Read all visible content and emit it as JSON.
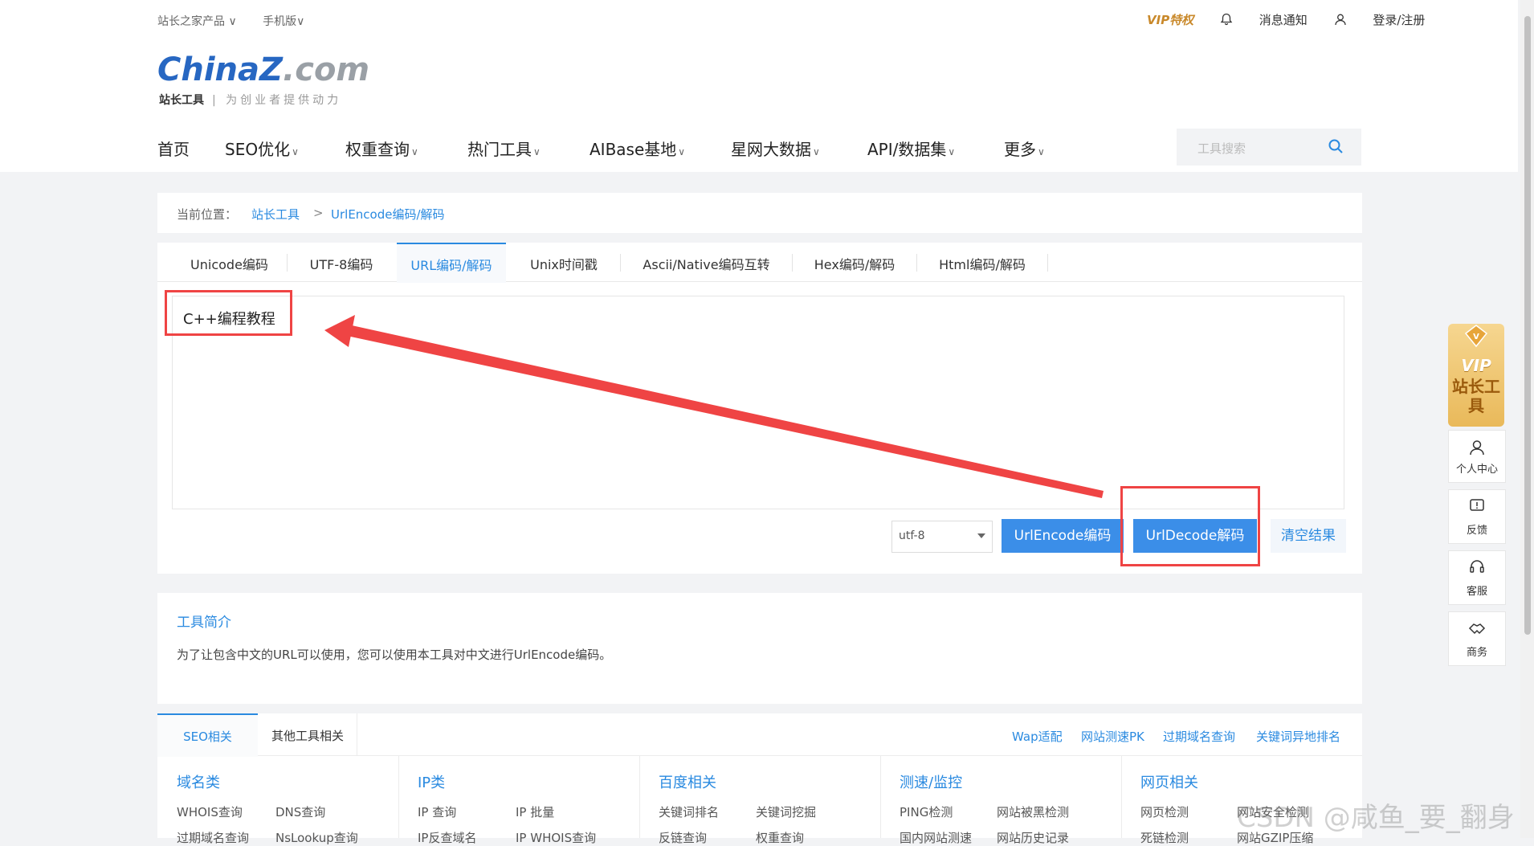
{
  "topbar": {
    "products": "站长之家产品 ∨",
    "mobile": "手机版∨",
    "vip": "VIP特权",
    "notify": "消息通知",
    "login": "登录/注册"
  },
  "logo": {
    "china": "China",
    "z": "Z",
    "com": ".com",
    "sub_bold": "站长工具",
    "slogan": "| 为创业者提供动力"
  },
  "nav": [
    {
      "label": "首页",
      "caret": ""
    },
    {
      "label": "SEO优化",
      "caret": "∨"
    },
    {
      "label": "权重查询",
      "caret": "∨"
    },
    {
      "label": "热门工具",
      "caret": "∨"
    },
    {
      "label": "AIBase基地",
      "caret": "∨"
    },
    {
      "label": "星网大数据",
      "caret": "∨"
    },
    {
      "label": "API/数据集",
      "caret": "∨"
    },
    {
      "label": "更多",
      "caret": "∨"
    }
  ],
  "search": {
    "placeholder": "工具搜索"
  },
  "breadcrumb": {
    "prefix": "当前位置：",
    "link1": "站长工具",
    "sep": ">",
    "link2": "UrlEncode编码/解码"
  },
  "tabs": [
    "Unicode编码",
    "UTF-8编码",
    "URL编码/解码",
    "Unix时间戳",
    "Ascii/Native编码互转",
    "Hex编码/解码",
    "Html编码/解码"
  ],
  "editor": {
    "content": "C++编程教程"
  },
  "controls": {
    "charset": "utf-8",
    "encode": "UrlEncode编码",
    "decode": "UrlDecode解码",
    "clear": "清空结果"
  },
  "intro": {
    "heading": "工具简介",
    "text": "为了让包含中文的URL可以使用，您可以使用本工具对中文进行UrlEncode编码。"
  },
  "related": {
    "tabs": [
      "SEO相关",
      "其他工具相关"
    ],
    "links": [
      "Wap适配",
      "网站测速PK",
      "过期域名查询",
      "关键词异地排名"
    ],
    "columns": [
      {
        "title": "域名类",
        "a1": "WHOIS查询",
        "a2": "DNS查询",
        "b1": "过期域名查询",
        "b2": "NsLookup查询"
      },
      {
        "title": "IP类",
        "a1": "IP 查询",
        "a2": "IP 批量",
        "b1": "IP反查域名",
        "b2": "IP WHOIS查询"
      },
      {
        "title": "百度相关",
        "a1": "关键词排名",
        "a2": "关键词挖掘",
        "b1": "反链查询",
        "b2": "权重查询"
      },
      {
        "title": "测速/监控",
        "a1": "PING检测",
        "a2": "网站被黑检测",
        "b1": "国内网站测速",
        "b2": "网站历史记录"
      },
      {
        "title": "网页相关",
        "a1": "网页检测",
        "a2": "网站安全检测",
        "b1": "死链检测",
        "b2": "网站GZIP压缩"
      }
    ]
  },
  "sidebar": {
    "vip_text": "VIP",
    "vip_cn": "站长工具",
    "personal": "个人中心",
    "feedback": "反馈",
    "service": "客服",
    "business": "商务"
  },
  "watermark": "CSDN @咸鱼_要_翻身"
}
